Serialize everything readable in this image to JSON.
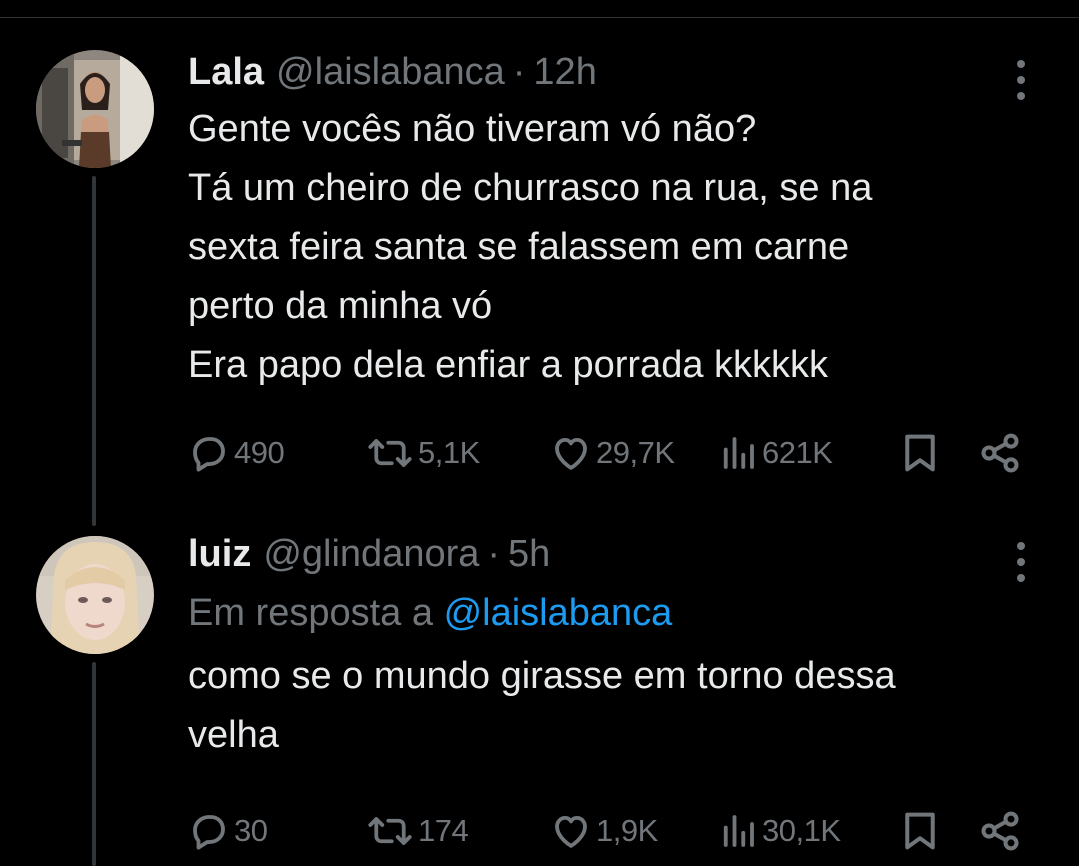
{
  "tweets": [
    {
      "display_name": "Lala",
      "handle": "@laislabanca",
      "separator": "·",
      "time": "12h",
      "text": "Gente vocês não tiveram vó não?\nTá um cheiro de churrasco na rua, se na\nsexta feira santa se falassem em carne\nperto da minha vó\nEra papo dela enfiar a porrada kkkkkk",
      "replies": "490",
      "reposts": "5,1K",
      "likes": "29,7K",
      "views": "621K"
    },
    {
      "display_name": "luiz",
      "handle": "@glindanora",
      "separator": "·",
      "time": "5h",
      "reply_prefix": "Em resposta a",
      "reply_mention": "@laislabanca",
      "text": "como se o mundo girasse em torno dessa\nvelha",
      "replies": "30",
      "reposts": "174",
      "likes": "1,9K",
      "views": "30,1K"
    }
  ],
  "icons": {
    "reply": "reply-icon",
    "repost": "repost-icon",
    "like": "heart-icon",
    "views": "views-icon",
    "bookmark": "bookmark-icon",
    "share": "share-icon",
    "more": "more-icon"
  },
  "colors": {
    "background": "#000000",
    "text": "#e7e9ea",
    "muted": "#71767b",
    "link": "#1d9bf0",
    "thread_line": "#333639"
  }
}
